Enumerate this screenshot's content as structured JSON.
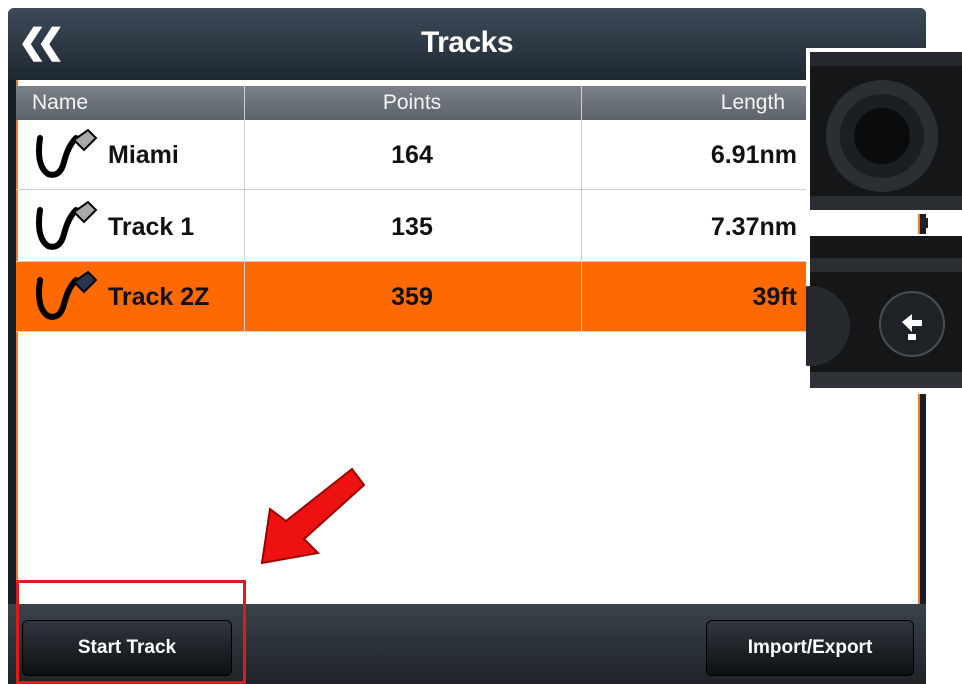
{
  "header": {
    "title": "Tracks",
    "back_icon": "double-chevron-left-icon"
  },
  "table": {
    "columns": [
      "Name",
      "Points",
      "Length"
    ],
    "rows": [
      {
        "name": "Miami",
        "points": "164",
        "length": "6.91nm",
        "selected": false
      },
      {
        "name": "Track 1",
        "points": "135",
        "length": "7.37nm",
        "selected": false
      },
      {
        "name": "Track 2Z",
        "points": "359",
        "length": "39ft",
        "selected": true
      }
    ]
  },
  "footer": {
    "start_label": "Start Track",
    "import_label": "Import/Export"
  },
  "colors": {
    "accent": "#ff6a00",
    "header_bg": "#2b3642",
    "annotation": "#e0191b"
  }
}
